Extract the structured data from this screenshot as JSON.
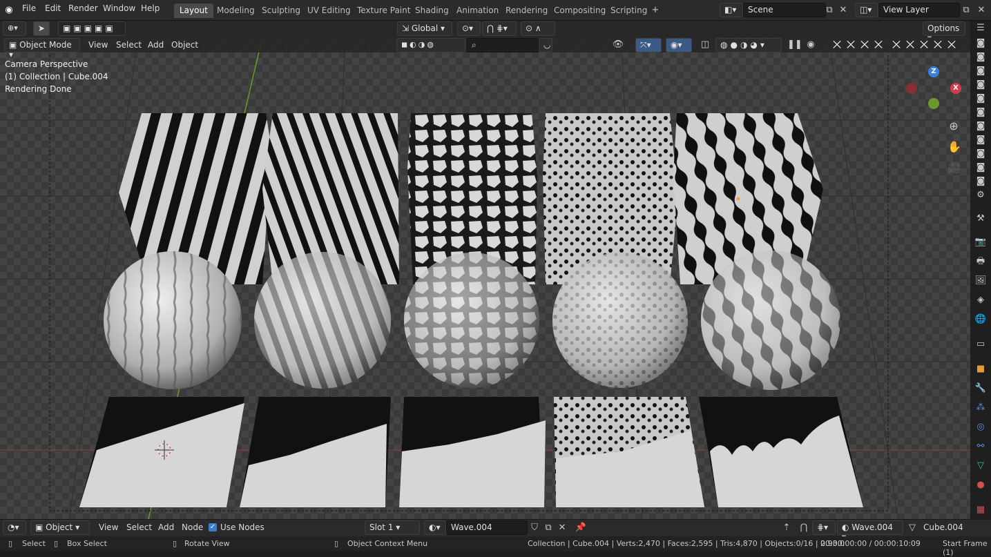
{
  "menu": [
    "File",
    "Edit",
    "Render",
    "Window",
    "Help"
  ],
  "workspaces": [
    "Layout",
    "Modeling",
    "Sculpting",
    "UV Editing",
    "Texture Paint",
    "Shading",
    "Animation",
    "Rendering",
    "Compositing",
    "Scripting"
  ],
  "active_workspace": "Layout",
  "scene": "Scene",
  "view_layer": "View Layer",
  "toolbar": {
    "transform_orientation": "Global",
    "options": "Options"
  },
  "viewport_header": {
    "mode": "Object Mode",
    "menus": [
      "View",
      "Select",
      "Add",
      "Object"
    ]
  },
  "overlay_text": {
    "view": "Camera Perspective",
    "collection": "(1) Collection | Cube.004",
    "status": "Rendering Done"
  },
  "gizmo": {
    "z": "Z",
    "x": "X"
  },
  "node_header": {
    "editor": "Object",
    "menus": [
      "View",
      "Select",
      "Add",
      "Node"
    ],
    "use_nodes": "Use Nodes",
    "slot": "Slot 1",
    "material": "Wave.004",
    "material2": "Wave.004",
    "object": "Cube.004"
  },
  "status_bar": {
    "select": "Select",
    "box_select": "Box Select",
    "rotate": "Rotate View",
    "context": "Object Context Menu",
    "stats": "Collection | Cube.004 | Verts:2,470 | Faces:2,595 | Tris:4,870 | Objects:0/16 | 2.93.0",
    "time": "00:00:00:00 / 00:00:10:09",
    "start": "Start Frame (1)"
  }
}
